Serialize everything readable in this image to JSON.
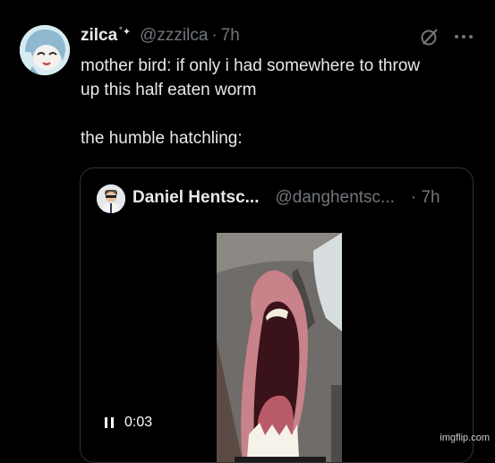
{
  "tweet": {
    "display_name": "zilca",
    "name_decoration": "˚✦",
    "handle": "@zzzilca",
    "separator": "·",
    "time": "7h",
    "text_line1": "mother bird: if only i had somewhere to throw",
    "text_line2": "up this half eaten worm",
    "text_line3": "the humble hatchling:"
  },
  "quoted_tweet": {
    "display_name": "Daniel Hentsc...",
    "handle": "@danghentsc...",
    "time": "· 7h",
    "video": {
      "elapsed": "0:03",
      "state": "playing",
      "control_icon": "pause-icon"
    }
  },
  "icons": [
    "avatar",
    "grok-icon",
    "more-icon",
    "pause-icon"
  ],
  "watermark": "imgflip.com",
  "colors": {
    "background": "#000000",
    "primary_text": "#e7e9ea",
    "secondary_text": "#71767b",
    "card_border": "#2f3336"
  }
}
